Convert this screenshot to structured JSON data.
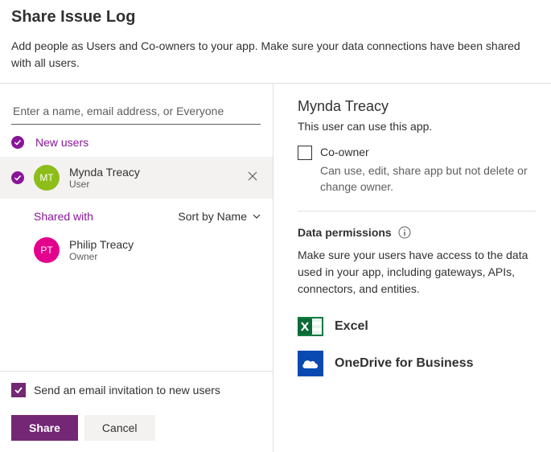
{
  "header": {
    "title": "Share Issue Log",
    "description": "Add people as Users and Co-owners to your app. Make sure your data connections have been shared with all users."
  },
  "search": {
    "placeholder": "Enter a name, email address, or Everyone"
  },
  "newUsers": {
    "label": "New users",
    "items": [
      {
        "initials": "MT",
        "name": "Mynda Treacy",
        "role": "User"
      }
    ]
  },
  "sharedWith": {
    "label": "Shared with",
    "sortLabel": "Sort by Name",
    "items": [
      {
        "initials": "PT",
        "name": "Philip Treacy",
        "role": "Owner"
      }
    ]
  },
  "sendEmail": {
    "label": "Send an email invitation to new users",
    "checked": true
  },
  "buttons": {
    "share": "Share",
    "cancel": "Cancel"
  },
  "details": {
    "name": "Mynda Treacy",
    "subtitle": "This user can use this app.",
    "coowner": {
      "label": "Co-owner",
      "description": "Can use, edit, share app but not delete or change owner."
    }
  },
  "dataPermissions": {
    "title": "Data permissions",
    "description": "Make sure your users have access to the data used in your app, including gateways, APIs, connectors, and entities.",
    "connectors": [
      {
        "name": "Excel"
      },
      {
        "name": "OneDrive for Business"
      }
    ]
  }
}
